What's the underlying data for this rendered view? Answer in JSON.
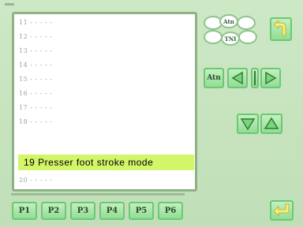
{
  "list": {
    "items": [
      {
        "label": "11 - - - - -"
      },
      {
        "label": "12 - - - - -"
      },
      {
        "label": "13 - - - - -"
      },
      {
        "label": "14 - - - - -"
      },
      {
        "label": "15 - - - - -"
      },
      {
        "label": "16 - - - - -"
      },
      {
        "label": "17 - - - - -"
      },
      {
        "label": "18 - - - - -"
      },
      {
        "label": "19 Presser foot stroke mode"
      },
      {
        "label": "20 - - - - -"
      }
    ],
    "selected_index": 8
  },
  "options": {
    "oval_top_label": "Atn",
    "oval_mid_label": "TNI"
  },
  "nav": {
    "auto_label": "Atn"
  },
  "tabs": [
    {
      "label": "P1"
    },
    {
      "label": "P2"
    },
    {
      "label": "P3"
    },
    {
      "label": "P4"
    },
    {
      "label": "P5"
    },
    {
      "label": "P6"
    }
  ],
  "colors": {
    "background": "#c6e4bf",
    "button_green": "#a8e6a8",
    "selection": "#d3f56a",
    "return_yellow": "#f4f27a"
  }
}
